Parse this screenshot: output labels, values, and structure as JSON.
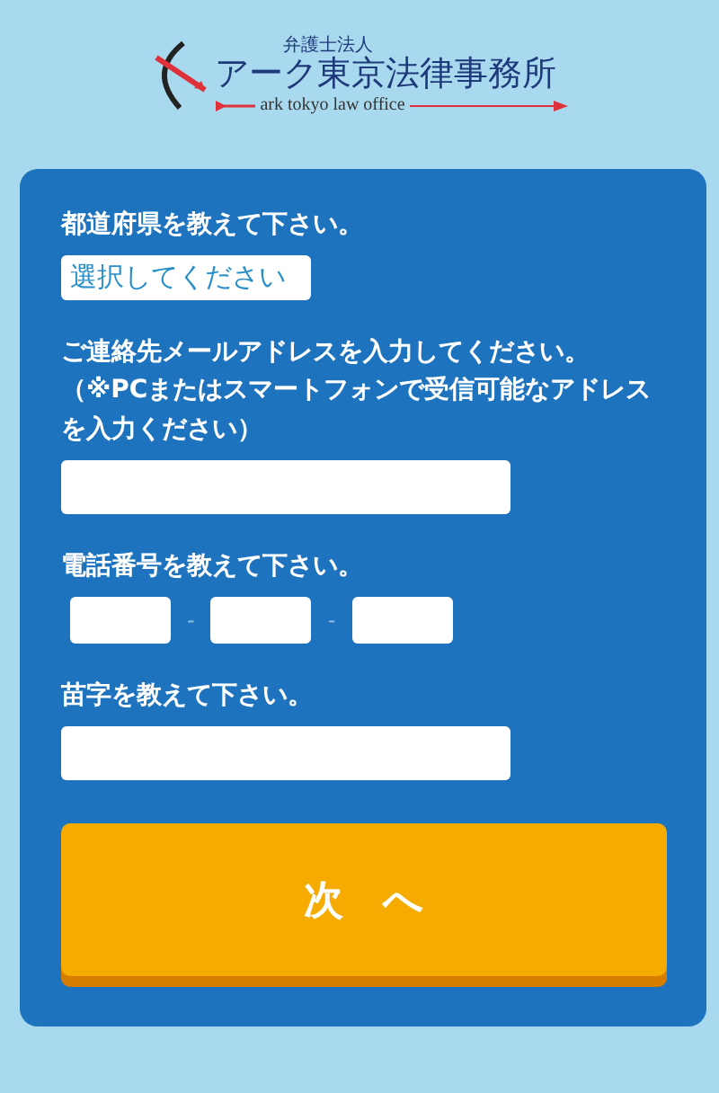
{
  "logo": {
    "subtitle": "弁護士法人",
    "name": "アーク東京法律事務所",
    "tagline": "ark tokyo law office"
  },
  "form": {
    "prefecture": {
      "label": "都道府県を教えて下さい。",
      "value": "選択してください"
    },
    "email": {
      "label": "ご連絡先メールアドレスを入力してください。",
      "note": "（※PCまたはスマートフォンで受信可能なアドレスを入力ください）"
    },
    "phone": {
      "label": "電話番号を教えて下さい。",
      "separators": [
        "-",
        "-"
      ]
    },
    "surname": {
      "label": "苗字を教えて下さい。"
    },
    "submit": "次　へ"
  }
}
